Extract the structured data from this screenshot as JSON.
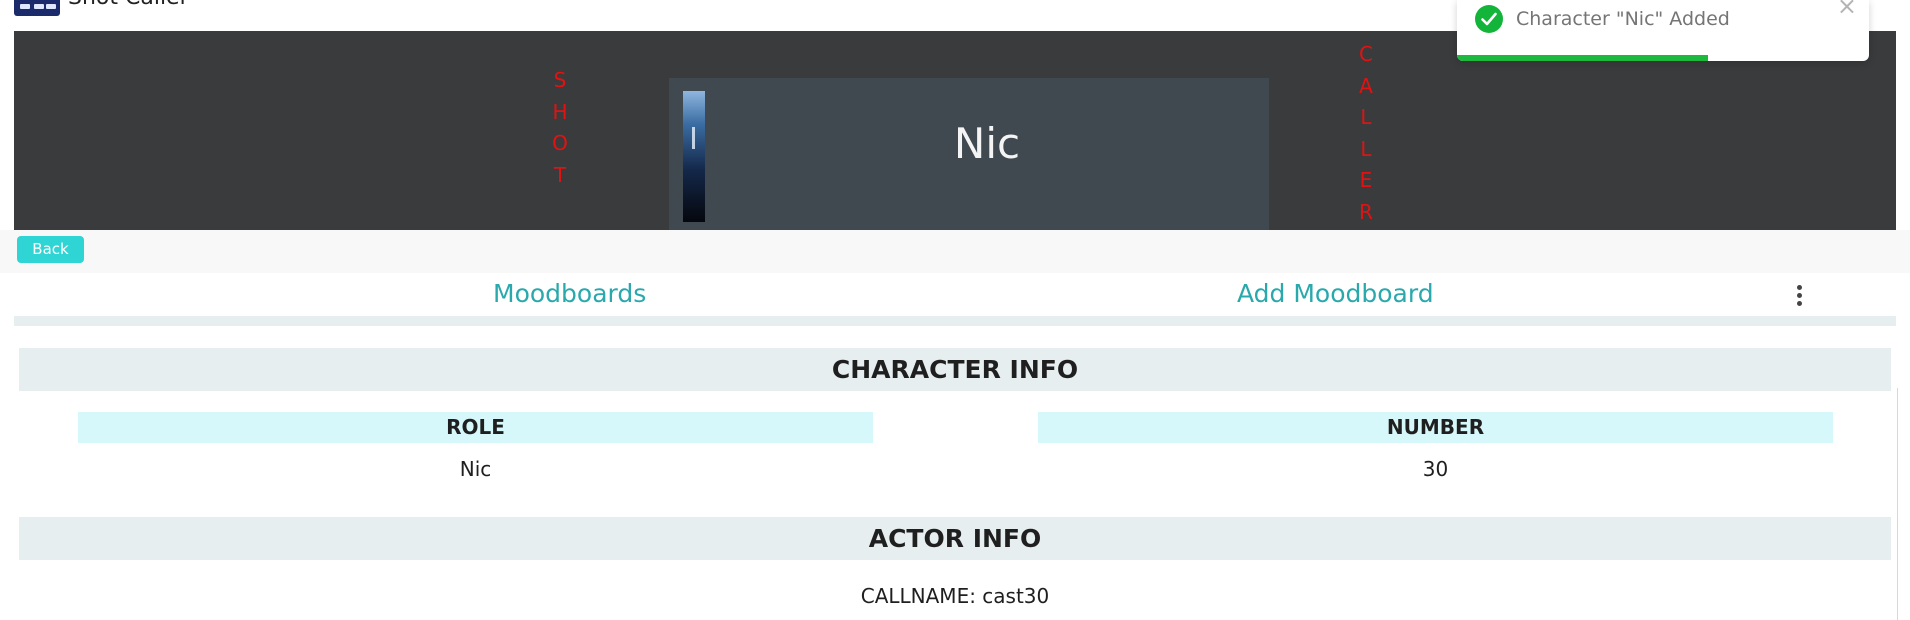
{
  "app": {
    "title": "Shot Caller"
  },
  "banner": {
    "left_vertical": [
      "S",
      "H",
      "O",
      "T"
    ],
    "right_vertical": [
      "C",
      "A",
      "L",
      "L",
      "E",
      "R"
    ],
    "character_name": "Nic"
  },
  "nav": {
    "back_label": "Back",
    "moodboards_label": "Moodboards",
    "add_moodboard_label": "Add Moodboard",
    "more_icon": "kebab-menu-icon"
  },
  "character_info": {
    "heading": "CHARACTER INFO",
    "role_header": "ROLE",
    "number_header": "NUMBER",
    "role_value": "Nic",
    "number_value": "30"
  },
  "actor_info": {
    "heading": "ACTOR INFO",
    "callname": "CALLNAME: cast30"
  },
  "toast": {
    "message": "Character \"Nic\" Added",
    "close_icon": "close-icon",
    "status_icon": "check-circle-icon",
    "progress": 0.61,
    "color": "#1db83e"
  },
  "colors": {
    "accent": "#2fd5d5",
    "link": "#2aa9ad",
    "banner_bg": "#393b3c",
    "vertical_text": "#e31212"
  }
}
